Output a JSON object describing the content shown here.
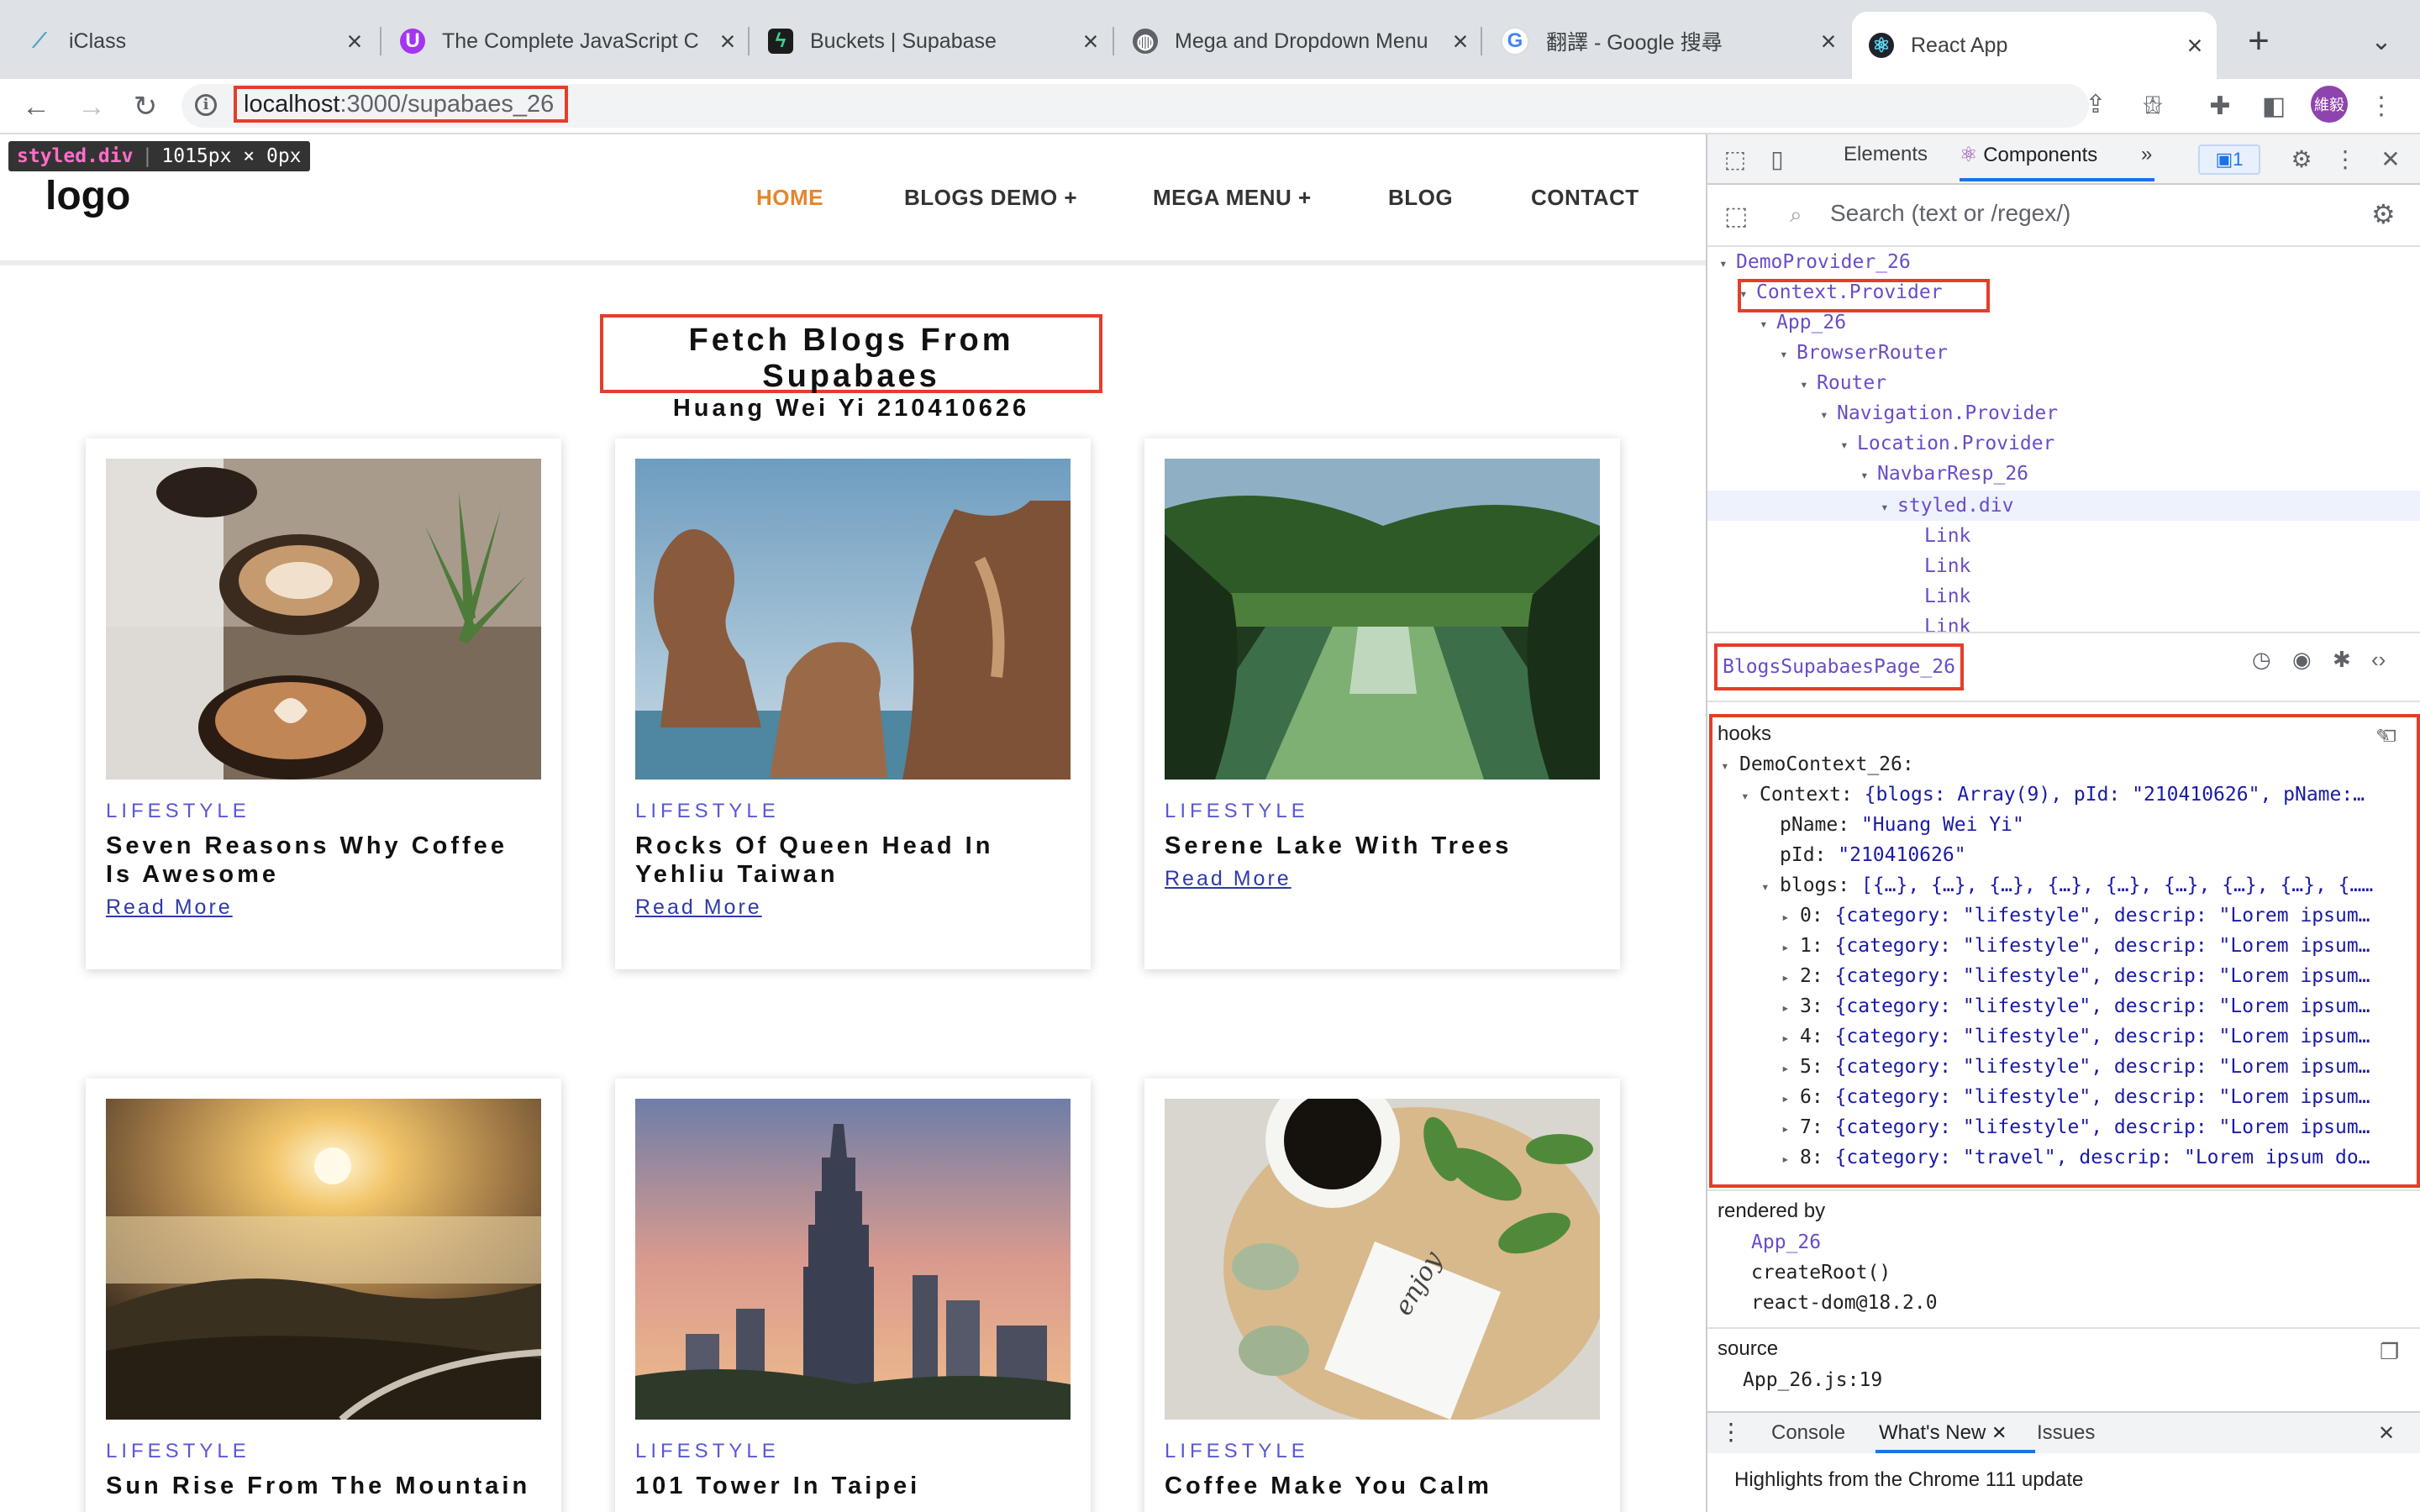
{
  "browser": {
    "tabs": [
      {
        "title": "iClass",
        "icon": "iclass-icon"
      },
      {
        "title": "The Complete JavaScript C",
        "icon": "udemy-icon"
      },
      {
        "title": "Buckets | Supabase",
        "icon": "supabase-icon"
      },
      {
        "title": "Mega and Dropdown Menu",
        "icon": "globe-icon"
      },
      {
        "title": "翻譯 - Google 搜尋",
        "icon": "google-icon"
      },
      {
        "title": "React App",
        "icon": "react-icon"
      }
    ],
    "active_tab": 5,
    "url_host": "localhost",
    "url_path": ":3000/supabaes_26",
    "profile_label": "維毅"
  },
  "inspect_tooltip": {
    "element": "styled.div",
    "size": "1015px × 0px"
  },
  "page": {
    "logo": "logo",
    "nav": [
      "HOME",
      "BLOGS DEMO +",
      "MEGA MENU +",
      "BLOG",
      "CONTACT"
    ],
    "title": "Fetch Blogs From Supabaes",
    "subtitle": "Huang Wei Yi 210410626",
    "cards": [
      {
        "category": "LIFESTYLE",
        "title": "Seven Reasons Why Coffee Is Awesome",
        "link": "Read More",
        "image": "coffee-cups-photo"
      },
      {
        "category": "LIFESTYLE",
        "title": "Rocks Of Queen Head In Yehliu Taiwan",
        "link": "Read More",
        "image": "rock-formation-photo"
      },
      {
        "category": "LIFESTYLE",
        "title": "Serene Lake With Trees",
        "link": "Read More",
        "image": "lake-trees-photo"
      },
      {
        "category": "LIFESTYLE",
        "title": "Sun Rise From The Mountain",
        "link": "",
        "image": "sunrise-mountain-photo"
      },
      {
        "category": "LIFESTYLE",
        "title": "101 Tower In Taipei",
        "link": "",
        "image": "taipei-101-photo"
      },
      {
        "category": "LIFESTYLE",
        "title": "Coffee Make You Calm",
        "link": "",
        "image": "coffee-calm-photo"
      }
    ]
  },
  "devtools": {
    "tabs": [
      "Elements",
      "Components"
    ],
    "more": "»",
    "issues_badge": "1",
    "search_placeholder": "Search (text or /regex/)",
    "tree": [
      {
        "label": "DemoProvider_26",
        "caret": "▾"
      },
      {
        "label": "Context.Provider",
        "caret": "▾"
      },
      {
        "label": "App_26",
        "caret": "▾"
      },
      {
        "label": "BrowserRouter",
        "caret": "▾"
      },
      {
        "label": "Router",
        "caret": "▾"
      },
      {
        "label": "Navigation.Provider",
        "caret": "▾"
      },
      {
        "label": "Location.Provider",
        "caret": "▾"
      },
      {
        "label": "NavbarResp_26",
        "caret": "▾"
      },
      {
        "label": "styled.div",
        "caret": "▾"
      },
      {
        "label": "Link",
        "caret": ""
      },
      {
        "label": "Link",
        "caret": ""
      },
      {
        "label": "Link",
        "caret": ""
      },
      {
        "label": "Link",
        "caret": ""
      }
    ],
    "selected_component": "BlogsSupabaesPage_26",
    "hooks_label": "hooks",
    "hooks": {
      "context_name": "DemoContext_26:",
      "context_key": "Context:",
      "context_value": "{blogs: Array(9), pId: \"210410626\", pName:…",
      "pName_key": "pName:",
      "pName_value": "\"Huang Wei Yi\"",
      "pId_key": "pId:",
      "pId_value": "\"210410626\"",
      "blogs_key": "blogs:",
      "blogs_value": "[{…}, {…}, {…}, {…}, {…}, {…}, {…}, {…}, {……",
      "blog_rows": [
        {
          "index": "0:",
          "value": "{category: \"lifestyle\", descrip: \"Lorem ipsum…"
        },
        {
          "index": "1:",
          "value": "{category: \"lifestyle\", descrip: \"Lorem ipsum…"
        },
        {
          "index": "2:",
          "value": "{category: \"lifestyle\", descrip: \"Lorem ipsum…"
        },
        {
          "index": "3:",
          "value": "{category: \"lifestyle\", descrip: \"Lorem ipsum…"
        },
        {
          "index": "4:",
          "value": "{category: \"lifestyle\", descrip: \"Lorem ipsum…"
        },
        {
          "index": "5:",
          "value": "{category: \"lifestyle\", descrip: \"Lorem ipsum…"
        },
        {
          "index": "6:",
          "value": "{category: \"lifestyle\", descrip: \"Lorem ipsum…"
        },
        {
          "index": "7:",
          "value": "{category: \"lifestyle\", descrip: \"Lorem ipsum…"
        },
        {
          "index": "8:",
          "value": "{category: \"travel\", descrip: \"Lorem ipsum do…"
        }
      ]
    },
    "rendered_by": {
      "label": "rendered by",
      "items": [
        "App_26",
        "createRoot()",
        "react-dom@18.2.0"
      ]
    },
    "source": {
      "label": "source",
      "file": "App_26.js:19"
    },
    "drawer": {
      "tabs": [
        "Console",
        "What's New",
        "Issues"
      ],
      "message": "Highlights from the Chrome 111 update"
    }
  },
  "colors": {
    "accent": "#e4862d",
    "category": "#5b56d6",
    "highlight_border": "#e53d2a",
    "component": "#6a4cc7"
  }
}
